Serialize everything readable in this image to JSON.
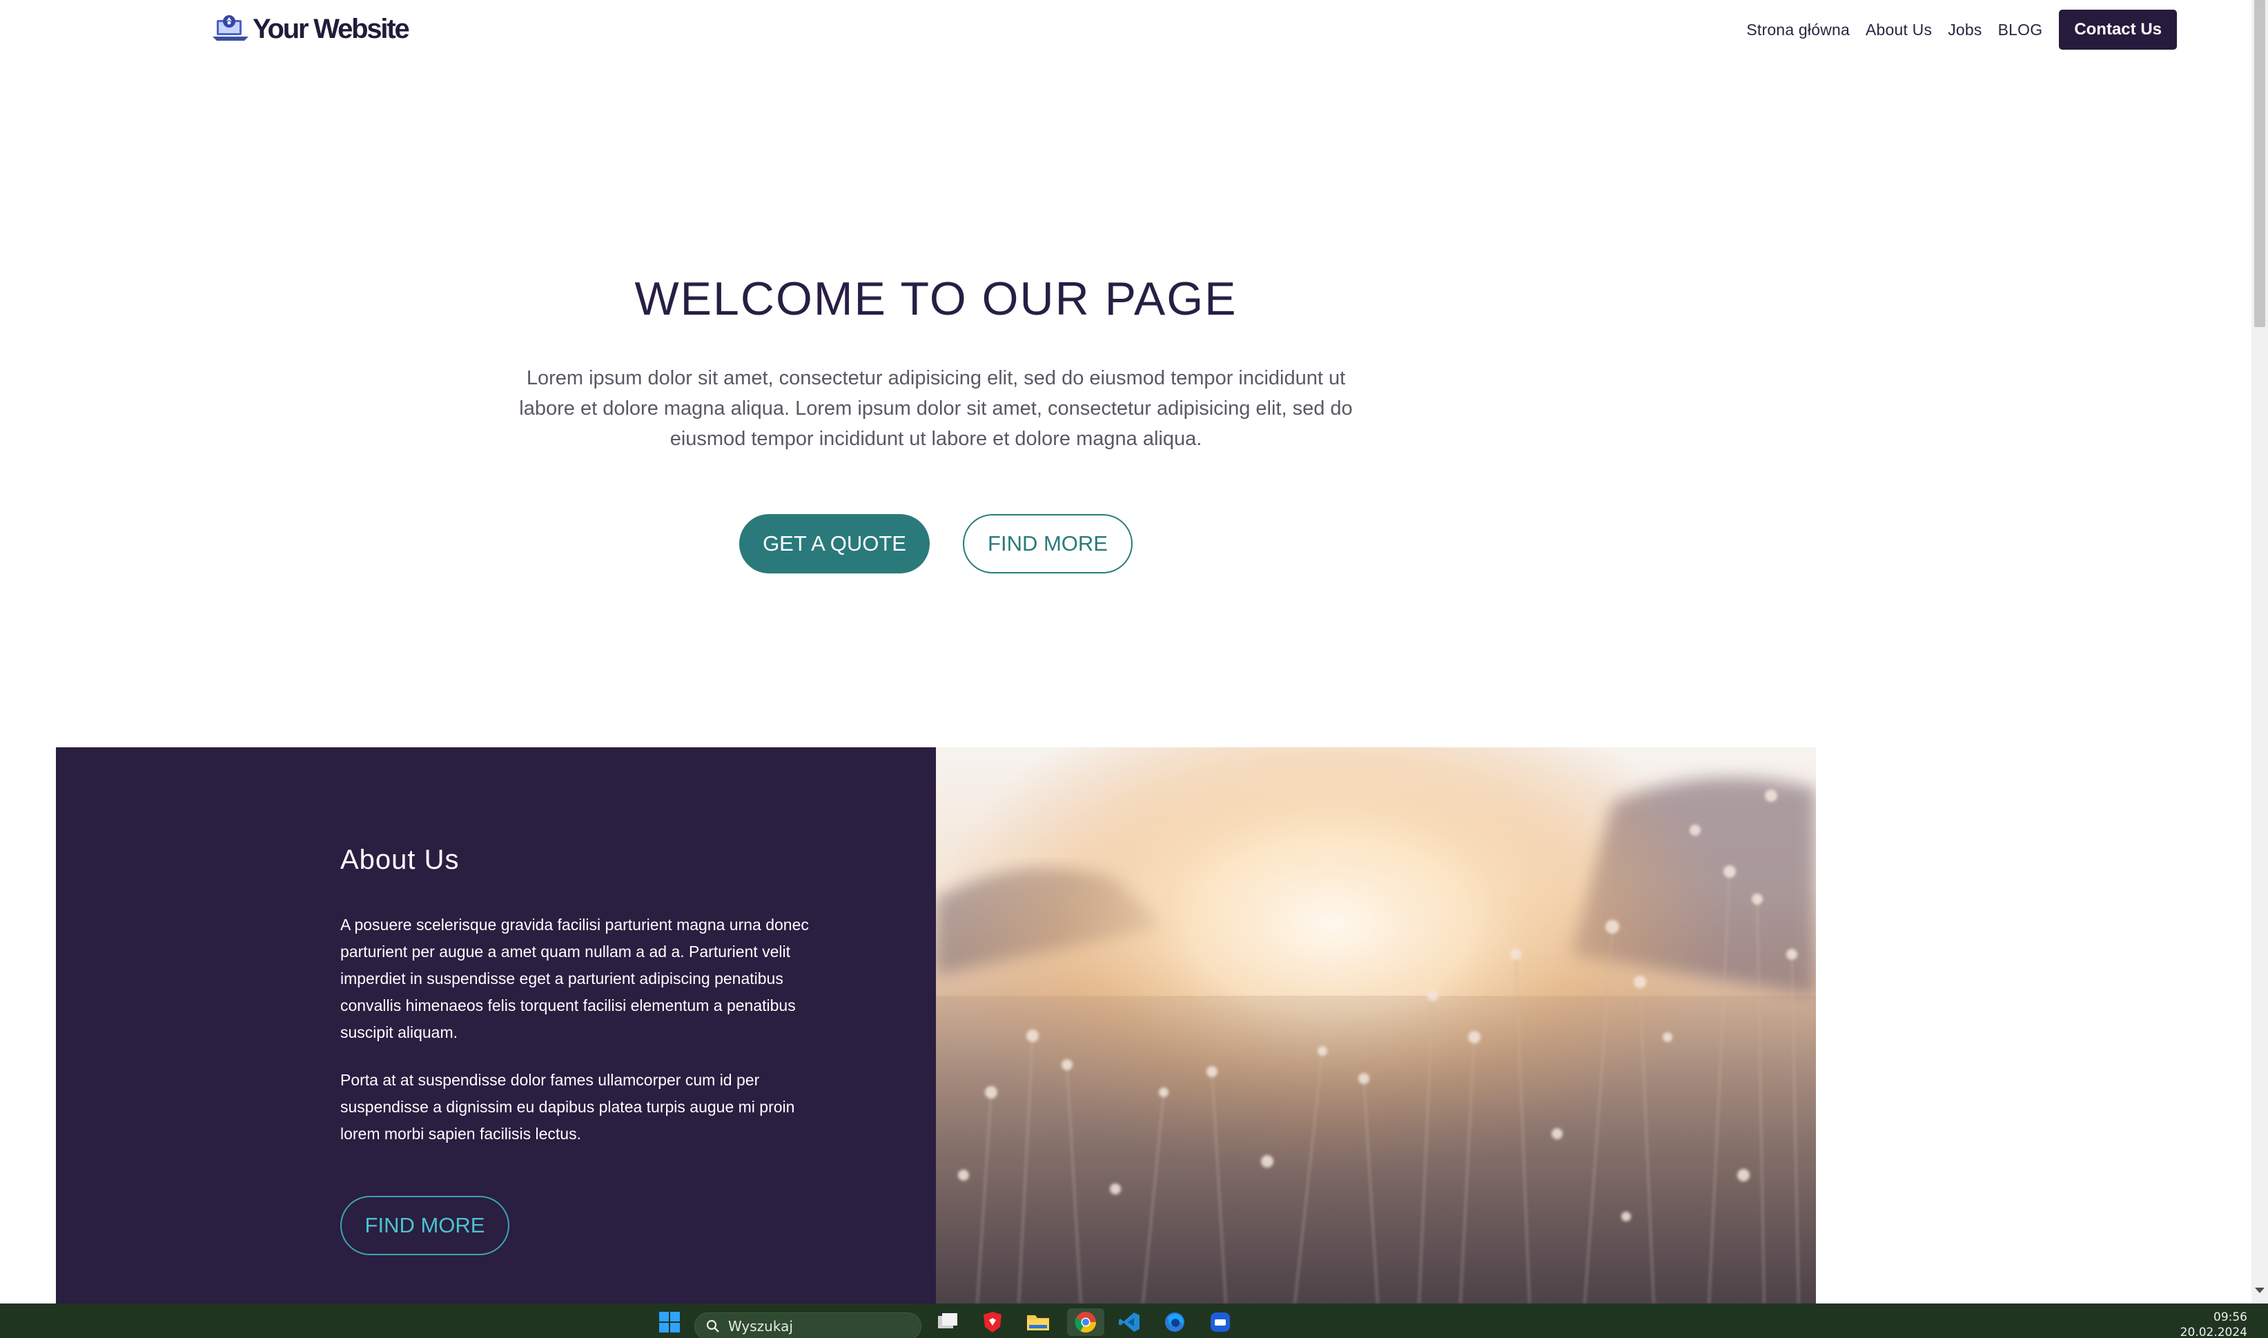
{
  "brand": {
    "name": "Your Website"
  },
  "nav": {
    "items": [
      "Strona główna",
      "About Us",
      "Jobs",
      "BLOG"
    ],
    "cta": "Contact Us"
  },
  "hero": {
    "title": "WELCOME TO OUR PAGE",
    "text": "Lorem ipsum dolor sit amet, consectetur adipisicing elit, sed do eiusmod tempor incididunt ut labore et dolore magna aliqua. Lorem ipsum dolor sit amet, consectetur adipisicing elit, sed do eiusmod tempor incididunt ut labore et dolore magna aliqua.",
    "primary_button": "GET A QUOTE",
    "secondary_button": "FIND MORE"
  },
  "about": {
    "title": "About Us",
    "paragraph1": "A posuere scelerisque gravida facilisi parturient magna urna donec parturient per augue a amet quam nullam a ad a. Parturient velit imperdiet in suspendisse eget a parturient adipiscing penatibus convallis himenaeos felis torquent facilisi elementum a penatibus suscipit aliquam.",
    "paragraph2": "Porta at at suspendisse dolor fames ullamcorper cum id per suspendisse a dignissim eu dapibus platea turpis augue mi proin lorem morbi sapien facilisis lectus.",
    "button": "FIND MORE",
    "image_icon": "field-flowers-sunset-photo"
  },
  "taskbar": {
    "search_placeholder": "Wyszukaj",
    "time": "09:56",
    "date": "20.02.2024",
    "apps": [
      "windows-start-icon",
      "file-explorer-icon",
      "brave-browser-icon",
      "folder-icon",
      "chrome-icon",
      "vscode-icon",
      "firefox-icon",
      "app-icon"
    ]
  },
  "colors": {
    "dark": "#271b3d",
    "teal": "#2a7a7b",
    "about_bg": "#2a1e41",
    "taskbar": "#1f3520"
  }
}
